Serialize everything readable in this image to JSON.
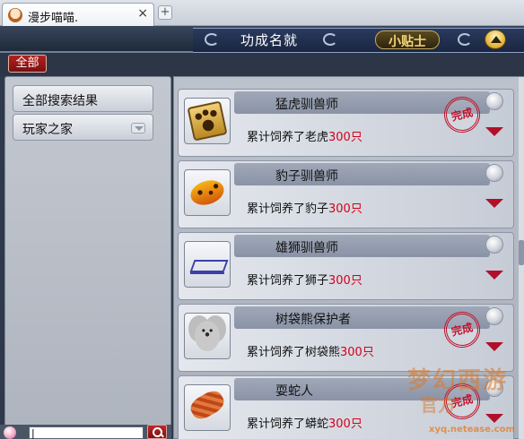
{
  "browser": {
    "tab_title": "漫步喵喵.",
    "close_glyph": "×",
    "new_tab_glyph": "+"
  },
  "header": {
    "title": "功成名就",
    "tips_label": "小贴士"
  },
  "filter": {
    "all_label": "全部"
  },
  "sidebar": {
    "items": [
      {
        "label": "全部搜索结果",
        "has_dropdown": false
      },
      {
        "label": "玩家之家",
        "has_dropdown": true
      }
    ]
  },
  "search": {
    "value": "|"
  },
  "achievements": [
    {
      "title": "猛虎驯兽师",
      "desc_prefix": "累计饲养了老虎",
      "count": "300只",
      "icon": "paw-icon",
      "completed": true,
      "badge_text": "完成"
    },
    {
      "title": "豹子驯兽师",
      "desc_prefix": "累计饲养了豹子",
      "count": "300只",
      "icon": "leopard-icon",
      "completed": false,
      "badge_text": ""
    },
    {
      "title": "雄狮驯兽师",
      "desc_prefix": "累计饲养了狮子",
      "count": "300只",
      "icon": "rack-icon",
      "completed": false,
      "badge_text": ""
    },
    {
      "title": "树袋熊保护者",
      "desc_prefix": "累计饲养了树袋熊",
      "count": "300只",
      "icon": "koala-icon",
      "completed": true,
      "badge_text": "完成"
    },
    {
      "title": "耍蛇人",
      "desc_prefix": "累计饲养了蟒蛇",
      "count": "300只",
      "icon": "snake-icon",
      "completed": true,
      "badge_text": "完成"
    }
  ],
  "watermark": {
    "logo": "梦幻西游",
    "sub": "官方",
    "url": "xyq.netease.com"
  },
  "colors": {
    "count_red": "#d4001a",
    "badge_red": "#c0102a",
    "tips_gold": "#f7d774"
  }
}
